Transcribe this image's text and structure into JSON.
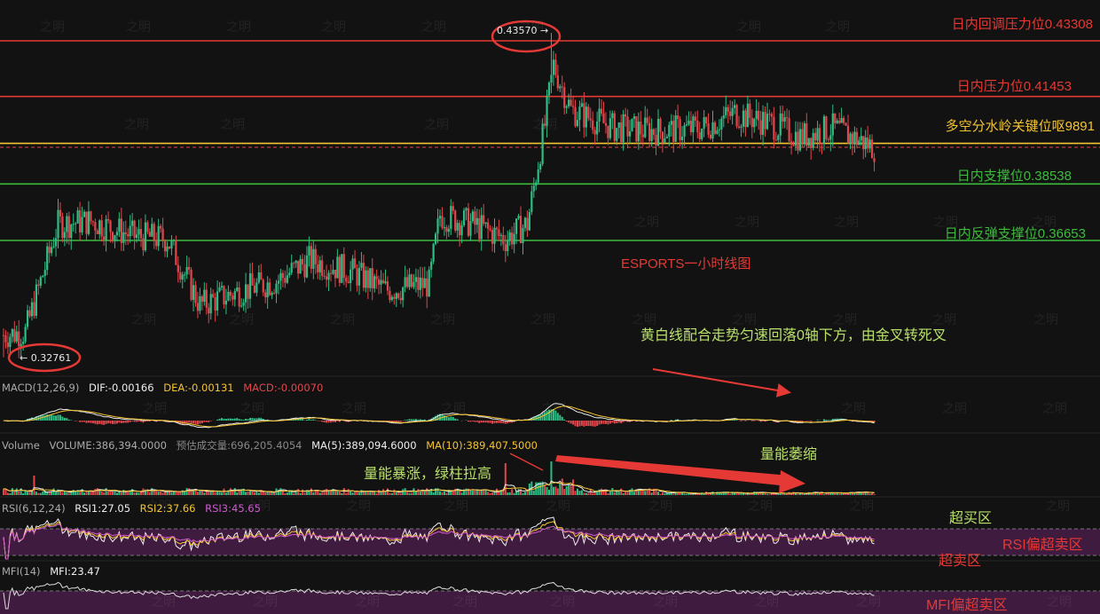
{
  "chart_data": {
    "type": "candlestick",
    "title": "ESPORTS一小时线图",
    "price_levels": [
      {
        "value": 0.43308,
        "label": "日内回调压力位0.43308",
        "color": "#e53935"
      },
      {
        "value": 0.41453,
        "label": "日内压力位0.41453",
        "color": "#e53935"
      },
      {
        "value": 0.39891,
        "label": "多空分水岭关键位呕9891",
        "color": "#f4c430"
      },
      {
        "value": 0.38538,
        "label": "日内支撑位0.38538",
        "color": "#3dbb3d"
      },
      {
        "value": 0.36653,
        "label": "日内反弹支撑位0.36653",
        "color": "#3dbb3d"
      }
    ],
    "high_marker": "0.43570 →",
    "low_marker": "← 0.32761",
    "ylim": [
      0.32,
      0.44
    ],
    "indicators": {
      "macd": {
        "name": "MACD(12,26,9)",
        "dif": "DIF:-0.00166",
        "dea": "DEA:-0.00131",
        "macd": "MACD:-0.00070"
      },
      "volume": {
        "name": "Volume",
        "volume": "VOLUME:386,394.0000",
        "est": "预估成交量:696,205.4054",
        "ma5": "MA(5):389,094.6000",
        "ma10": "MA(10):389,407.5000"
      },
      "rsi": {
        "name": "RSI(6,12,24)",
        "rsi1": "RSI1:27.05",
        "rsi2": "RSI2:37.66",
        "rsi3": "RSI3:45.65"
      },
      "mfi": {
        "name": "MFI(14)",
        "mfi": "MFI:23.47"
      }
    }
  },
  "annotations": {
    "macd_note": "黄白线配合走势匀速回落0轴下方，由金叉转死叉",
    "vol_surge": "量能暴涨，绿柱拉高",
    "vol_shrink": "量能萎缩",
    "overbought": "超买区",
    "oversold": "超卖区",
    "rsi_oversold": "RSI偏超卖区",
    "mfi_oversold": "MFI偏超卖区"
  },
  "watermark": "之明",
  "colors": {
    "up": "#2ebd85",
    "down": "#e0474c",
    "bg": "#121212"
  }
}
